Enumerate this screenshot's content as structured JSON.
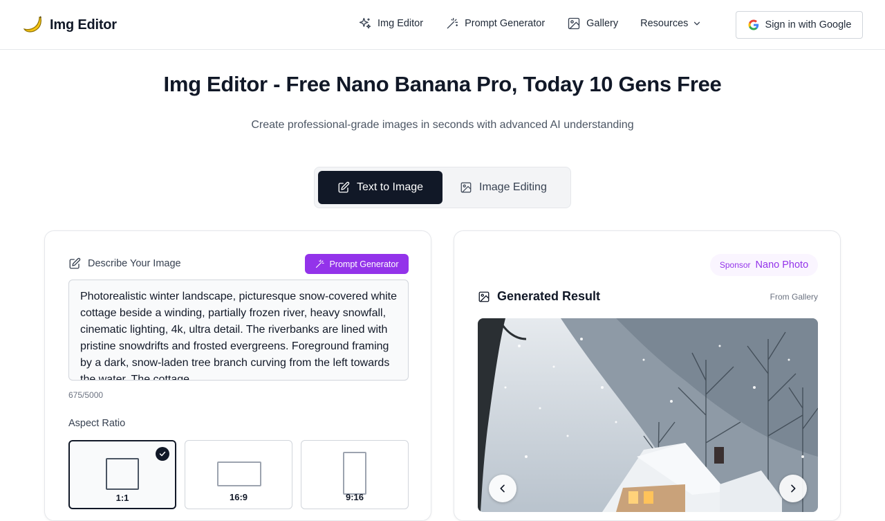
{
  "header": {
    "logo_text": "Img Editor",
    "nav": [
      {
        "label": "Img Editor",
        "icon": "sparkles-icon"
      },
      {
        "label": "Prompt Generator",
        "icon": "magic-wand-icon"
      },
      {
        "label": "Gallery",
        "icon": "image-icon"
      },
      {
        "label": "Resources",
        "icon": "chevron-down-icon"
      }
    ],
    "signin_label": "Sign in with Google"
  },
  "hero": {
    "title": "Img Editor - Free Nano Banana Pro, Today 10 Gens Free",
    "subtitle": "Create professional-grade images in seconds with advanced AI understanding"
  },
  "mode_tabs": {
    "active": "Text to Image",
    "inactive": "Image Editing"
  },
  "left_panel": {
    "describe_label": "Describe Your Image",
    "prompt_generator_label": "Prompt Generator",
    "prompt_text": "Photorealistic winter landscape, picturesque snow-covered white cottage beside a winding, partially frozen river, heavy snowfall, cinematic lighting, 4k, ultra detail. The riverbanks are lined with pristine snowdrifts and frosted evergreens. Foreground framing by a dark, snow-laden tree branch curving from the left towards the water. The cottage",
    "char_count": "675/5000",
    "aspect_label": "Aspect Ratio",
    "ratios": [
      "1:1",
      "16:9",
      "9:16"
    ],
    "selected_ratio": "1:1"
  },
  "right_panel": {
    "sponsor_tag": "Sponsor",
    "sponsor_name": "Nano Photo",
    "result_title": "Generated Result",
    "from_gallery": "From Gallery"
  },
  "colors": {
    "primary_dark": "#111827",
    "accent_purple": "#9333ea",
    "sponsor_bg": "#faf5ff"
  }
}
